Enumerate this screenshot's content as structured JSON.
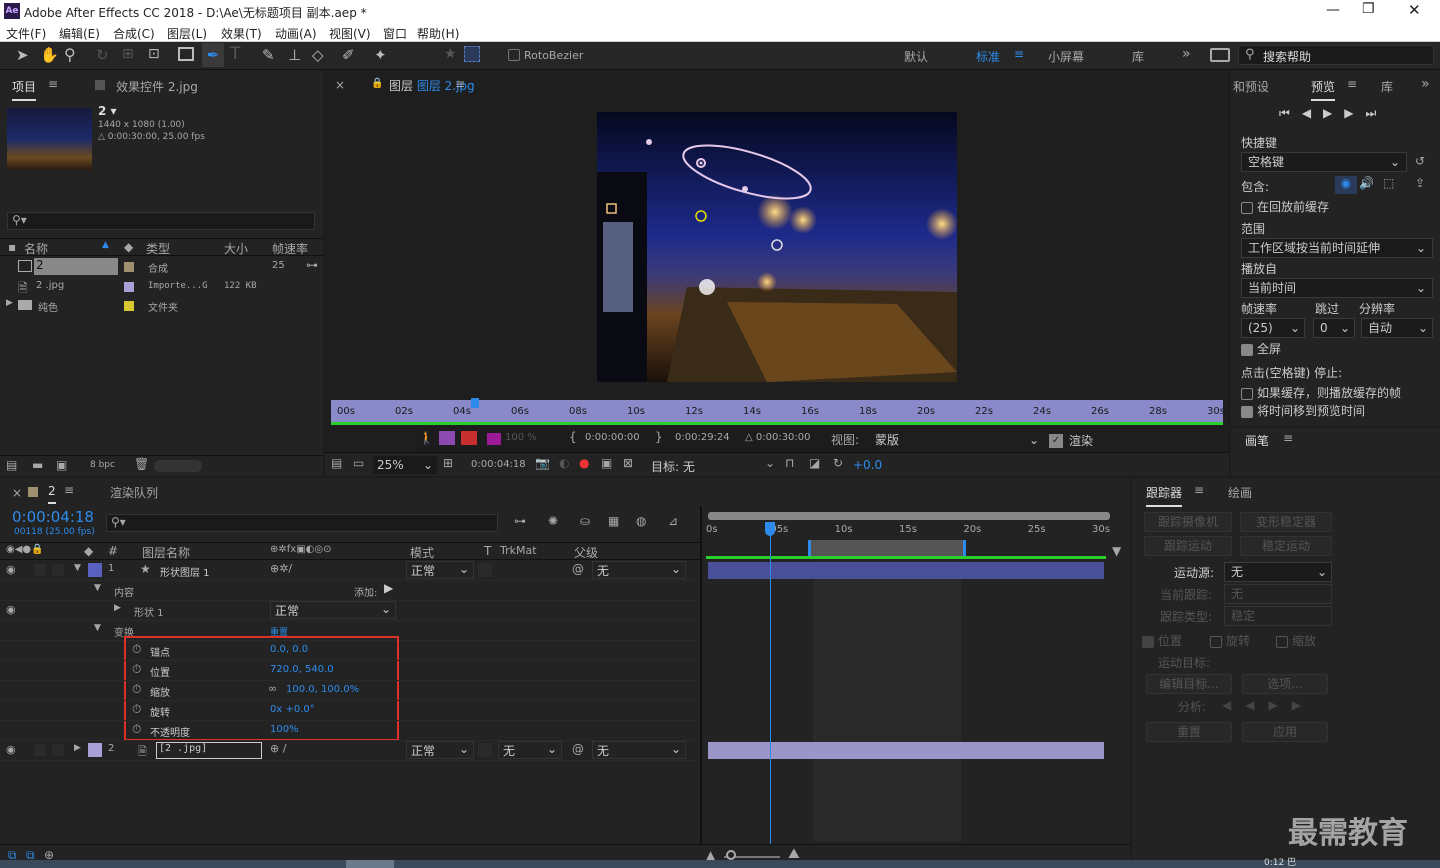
{
  "window": {
    "title": "Adobe After Effects CC 2018 - D:\\Ae\\无标题项目 副本.aep *",
    "app_icon": "Ae"
  },
  "menu": [
    "文件(F)",
    "编辑(E)",
    "合成(C)",
    "图层(L)",
    "效果(T)",
    "动画(A)",
    "视图(V)",
    "窗口",
    "帮助(H)"
  ],
  "toolbar": {
    "rotobezier": "RotoBezier",
    "workspaces": [
      "默认",
      "标准",
      "小屏幕",
      "库"
    ],
    "active_workspace": "标准",
    "search_placeholder": "搜索帮助"
  },
  "project": {
    "tab": "项目",
    "effects_tab": "效果控件 2.jpg",
    "comp_name": "2 ▾",
    "info": [
      "1440 x 1080 (1.00)",
      "△ 0:00:30:00, 25.00 fps"
    ],
    "search_placeholder": "",
    "columns": [
      "名称",
      "类型",
      "大小",
      "帧速率"
    ],
    "items": [
      {
        "name": "2",
        "type": "合成",
        "size": "",
        "fps": "25",
        "label": "#a09070"
      },
      {
        "name": "2 .jpg",
        "type": "Importe...G",
        "size": "122 KB",
        "fps": "",
        "label": "#a9a0d8"
      },
      {
        "name": "纯色",
        "type": "文件夹",
        "size": "",
        "fps": "",
        "label": "#d8c830"
      }
    ],
    "bpc": "8 bpc"
  },
  "viewer": {
    "tab": "图层 2.jpg",
    "ruler": [
      "00s",
      "02s",
      "04s",
      "06s",
      "08s",
      "10s",
      "12s",
      "14s",
      "16s",
      "18s",
      "20s",
      "22s",
      "24s",
      "26s",
      "28s",
      "30s"
    ],
    "in": "0:00:00:00",
    "out": "0:00:29:24",
    "dur": "△ 0:00:30:00",
    "view_label": "视图:",
    "view": "蒙版",
    "render": "渲染",
    "opacity": "100 %",
    "zoom": "25%",
    "time": "0:00:04:18",
    "target": "目标: 无",
    "exposure": "+0.0"
  },
  "preview": {
    "tabs": [
      "和预设",
      "预览",
      "库"
    ],
    "shortcut_label": "快捷键",
    "shortcut": "空格键",
    "include_label": "包含:",
    "cache_before": "在回放前缓存",
    "range_label": "范围",
    "range": "工作区域按当前时间延伸",
    "play_from_label": "播放自",
    "play_from": "当前时间",
    "fps_label": "帧速率",
    "skip_label": "跳过",
    "res_label": "分辨率",
    "fps": "(25)",
    "skip": "0",
    "res": "自动",
    "fullscreen": "全屏",
    "stop_label": "点击(空格键) 停止:",
    "stop_cache": "如果缓存，则播放缓存的帧",
    "move_time": "将时间移到预览时间",
    "brush_tab": "画笔"
  },
  "timeline": {
    "comp_tab": "2",
    "render_queue": "渲染队列",
    "timecode": "0:00:04:18",
    "frames": "00118 (25.00 fps)",
    "cols": {
      "layer_name": "图层名称",
      "mode": "模式",
      "t": "T",
      "trkmat": "TrkMat",
      "parent": "父级"
    },
    "layers": [
      {
        "num": "1",
        "name": "形状图层 1",
        "mode": "正常",
        "parent": "无",
        "color": "#5a60c0"
      },
      {
        "num": "2",
        "name": "[2 .jpg]",
        "mode": "正常",
        "trkmat": "无",
        "parent": "无",
        "color": "#a9a0d8"
      }
    ],
    "contents": "内容",
    "add": "添加:",
    "shape": "形状 1",
    "shape_mode": "正常",
    "transform": "变换",
    "reset": "重置",
    "props": [
      {
        "name": "锚点",
        "value": "0.0, 0.0"
      },
      {
        "name": "位置",
        "value": "720.0, 540.0"
      },
      {
        "name": "缩放",
        "value": "100.0, 100.0%"
      },
      {
        "name": "旋转",
        "value": "0x +0.0°"
      },
      {
        "name": "不透明度",
        "value": "100%"
      }
    ],
    "ruler": [
      "0s",
      "05s",
      "10s",
      "15s",
      "20s",
      "25s",
      "30s"
    ]
  },
  "tracker": {
    "tabs": [
      "跟踪器",
      "绘画"
    ],
    "btns": [
      "跟踪摄像机",
      "变形稳定器",
      "跟踪运动",
      "稳定运动"
    ],
    "motion_src_label": "运动源:",
    "motion_src": "无",
    "cur_track_label": "当前跟踪:",
    "cur_track": "无",
    "track_type_label": "跟踪类型:",
    "track_type": "稳定",
    "checks": [
      "位置",
      "旋转",
      "缩放"
    ],
    "motion_target": "运动目标:",
    "edit_target": "编辑目标...",
    "options": "选项...",
    "analyze": "分析:",
    "reset": "重置",
    "apply": "应用"
  },
  "watermark": "最需教育",
  "status": "0:12 巴"
}
